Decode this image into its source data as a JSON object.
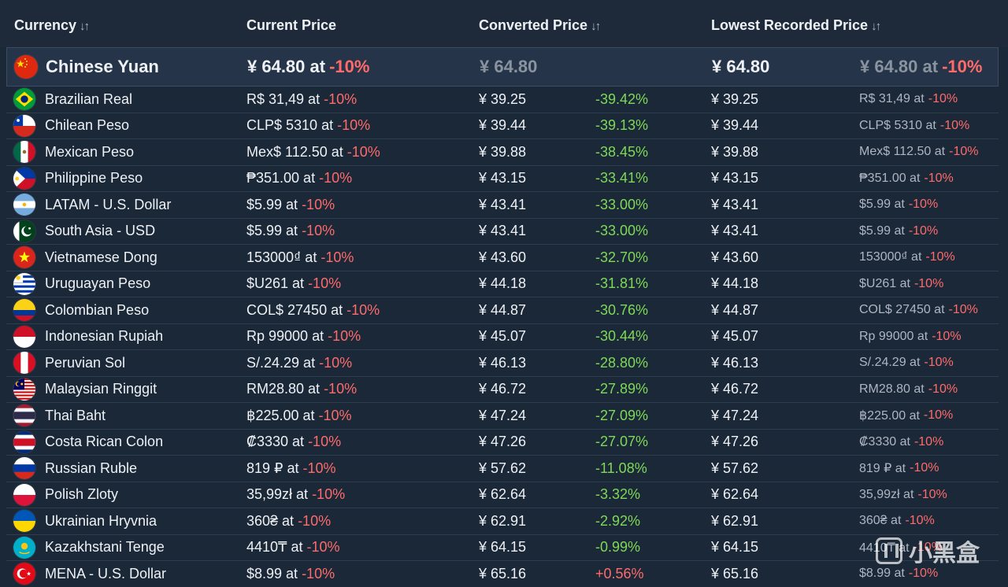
{
  "header": {
    "currency": "Currency",
    "current_price": "Current Price",
    "converted_price": "Converted Price",
    "lowest_recorded_price": "Lowest Recorded Price",
    "sort_glyph": "↓↑"
  },
  "base_row": {
    "flag": "cn",
    "name": "Chinese Yuan",
    "current": "¥ 64.80 at",
    "current_discount": "-10%",
    "converted": "¥ 64.80",
    "diff": "",
    "lowest": "¥ 64.80",
    "lowest_current": "¥ 64.80 at",
    "lowest_discount": "-10%"
  },
  "rows": [
    {
      "flag": "br",
      "name": "Brazilian Real",
      "current": "R$ 31,49 at",
      "discount": "-10%",
      "converted": "¥ 39.25",
      "diff": "-39.42%",
      "diff_sign": "neg",
      "lowest": "¥ 39.25",
      "lowest_current": "R$ 31,49 at",
      "lowest_discount": "-10%"
    },
    {
      "flag": "cl",
      "name": "Chilean Peso",
      "current": "CLP$ 5310 at",
      "discount": "-10%",
      "converted": "¥ 39.44",
      "diff": "-39.13%",
      "diff_sign": "neg",
      "lowest": "¥ 39.44",
      "lowest_current": "CLP$ 5310 at",
      "lowest_discount": "-10%"
    },
    {
      "flag": "mx",
      "name": "Mexican Peso",
      "current": "Mex$ 112.50 at",
      "discount": "-10%",
      "converted": "¥ 39.88",
      "diff": "-38.45%",
      "diff_sign": "neg",
      "lowest": "¥ 39.88",
      "lowest_current": "Mex$ 112.50 at",
      "lowest_discount": "-10%"
    },
    {
      "flag": "ph",
      "name": "Philippine Peso",
      "current": "₱351.00 at",
      "discount": "-10%",
      "converted": "¥ 43.15",
      "diff": "-33.41%",
      "diff_sign": "neg",
      "lowest": "¥ 43.15",
      "lowest_current": "₱351.00 at",
      "lowest_discount": "-10%"
    },
    {
      "flag": "ar",
      "name": "LATAM - U.S. Dollar",
      "current": "$5.99 at",
      "discount": "-10%",
      "converted": "¥ 43.41",
      "diff": "-33.00%",
      "diff_sign": "neg",
      "lowest": "¥ 43.41",
      "lowest_current": "$5.99 at",
      "lowest_discount": "-10%"
    },
    {
      "flag": "pk",
      "name": "South Asia - USD",
      "current": "$5.99 at",
      "discount": "-10%",
      "converted": "¥ 43.41",
      "diff": "-33.00%",
      "diff_sign": "neg",
      "lowest": "¥ 43.41",
      "lowest_current": "$5.99 at",
      "lowest_discount": "-10%"
    },
    {
      "flag": "vn",
      "name": "Vietnamese Dong",
      "current": "153000₫ at",
      "discount": "-10%",
      "converted": "¥ 43.60",
      "diff": "-32.70%",
      "diff_sign": "neg",
      "lowest": "¥ 43.60",
      "lowest_current": "153000₫ at",
      "lowest_discount": "-10%"
    },
    {
      "flag": "uy",
      "name": "Uruguayan Peso",
      "current": "$U261 at",
      "discount": "-10%",
      "converted": "¥ 44.18",
      "diff": "-31.81%",
      "diff_sign": "neg",
      "lowest": "¥ 44.18",
      "lowest_current": "$U261 at",
      "lowest_discount": "-10%"
    },
    {
      "flag": "co",
      "name": "Colombian Peso",
      "current": "COL$ 27450 at",
      "discount": "-10%",
      "converted": "¥ 44.87",
      "diff": "-30.76%",
      "diff_sign": "neg",
      "lowest": "¥ 44.87",
      "lowest_current": "COL$ 27450 at",
      "lowest_discount": "-10%"
    },
    {
      "flag": "id",
      "name": "Indonesian Rupiah",
      "current": "Rp 99000 at",
      "discount": "-10%",
      "converted": "¥ 45.07",
      "diff": "-30.44%",
      "diff_sign": "neg",
      "lowest": "¥ 45.07",
      "lowest_current": "Rp 99000 at",
      "lowest_discount": "-10%"
    },
    {
      "flag": "pe",
      "name": "Peruvian Sol",
      "current": "S/.24.29 at",
      "discount": "-10%",
      "converted": "¥ 46.13",
      "diff": "-28.80%",
      "diff_sign": "neg",
      "lowest": "¥ 46.13",
      "lowest_current": "S/.24.29 at",
      "lowest_discount": "-10%"
    },
    {
      "flag": "my",
      "name": "Malaysian Ringgit",
      "current": "RM28.80 at",
      "discount": "-10%",
      "converted": "¥ 46.72",
      "diff": "-27.89%",
      "diff_sign": "neg",
      "lowest": "¥ 46.72",
      "lowest_current": "RM28.80 at",
      "lowest_discount": "-10%"
    },
    {
      "flag": "th",
      "name": "Thai Baht",
      "current": "฿225.00 at",
      "discount": "-10%",
      "converted": "¥ 47.24",
      "diff": "-27.09%",
      "diff_sign": "neg",
      "lowest": "¥ 47.24",
      "lowest_current": "฿225.00 at",
      "lowest_discount": "-10%"
    },
    {
      "flag": "cr",
      "name": "Costa Rican Colon",
      "current": "₡3330 at",
      "discount": "-10%",
      "converted": "¥ 47.26",
      "diff": "-27.07%",
      "diff_sign": "neg",
      "lowest": "¥ 47.26",
      "lowest_current": "₡3330 at",
      "lowest_discount": "-10%"
    },
    {
      "flag": "ru",
      "name": "Russian Ruble",
      "current": "819 ₽ at",
      "discount": "-10%",
      "converted": "¥ 57.62",
      "diff": "-11.08%",
      "diff_sign": "neg",
      "lowest": "¥ 57.62",
      "lowest_current": "819 ₽ at",
      "lowest_discount": "-10%"
    },
    {
      "flag": "pl",
      "name": "Polish Zloty",
      "current": "35,99zł at",
      "discount": "-10%",
      "converted": "¥ 62.64",
      "diff": "-3.32%",
      "diff_sign": "neg",
      "lowest": "¥ 62.64",
      "lowest_current": "35,99zł at",
      "lowest_discount": "-10%"
    },
    {
      "flag": "ua",
      "name": "Ukrainian Hryvnia",
      "current": "360₴ at",
      "discount": "-10%",
      "converted": "¥ 62.91",
      "diff": "-2.92%",
      "diff_sign": "neg",
      "lowest": "¥ 62.91",
      "lowest_current": "360₴ at",
      "lowest_discount": "-10%"
    },
    {
      "flag": "kz",
      "name": "Kazakhstani Tenge",
      "current": "4410₸ at",
      "discount": "-10%",
      "converted": "¥ 64.15",
      "diff": "-0.99%",
      "diff_sign": "neg",
      "lowest": "¥ 64.15",
      "lowest_current": "4410₸ at",
      "lowest_discount": "-10%"
    },
    {
      "flag": "tr",
      "name": "MENA - U.S. Dollar",
      "current": "$8.99 at",
      "discount": "-10%",
      "converted": "¥ 65.16",
      "diff": "+0.56%",
      "diff_sign": "pos",
      "lowest": "¥ 65.16",
      "lowest_current": "$8.99 at",
      "lowest_discount": "-10%"
    }
  ],
  "colors": {
    "background": "#1b2838",
    "header_bg": "#1e2a3a",
    "base_row_bg": "#253448",
    "discount_red": "#ff6b6b",
    "savings_green": "#7ed957"
  },
  "watermark": {
    "text": "小黑盒"
  }
}
